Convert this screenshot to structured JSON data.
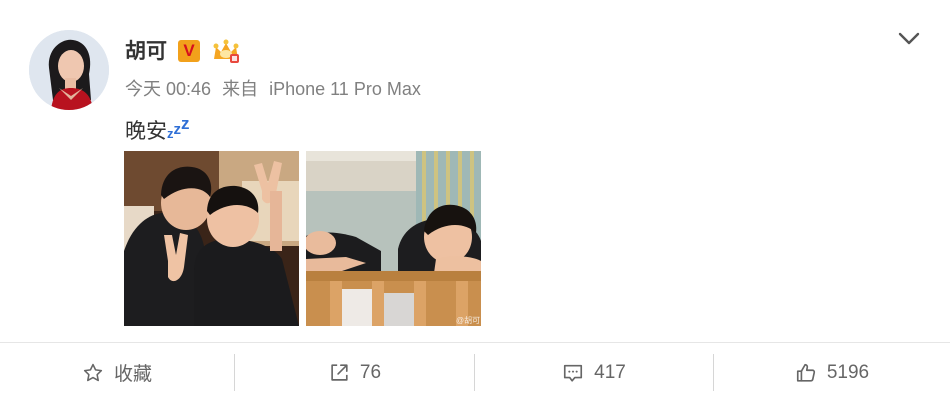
{
  "post": {
    "author": "胡可",
    "vip_badge": "V",
    "time": "今天 00:46",
    "from_label": "来自",
    "device": "iPhone 11 Pro Max",
    "text": "晚安",
    "zzz": [
      "z",
      "z",
      "z"
    ],
    "watermark": "@胡可"
  },
  "actions": {
    "favorite_label": "收藏",
    "repost_count": "76",
    "comment_count": "417",
    "like_count": "5196"
  },
  "colors": {
    "vip_bg": "#f2a11b",
    "vip_text": "#d6101d",
    "zzz": "#2f6fd6",
    "meta_text": "#808080"
  }
}
